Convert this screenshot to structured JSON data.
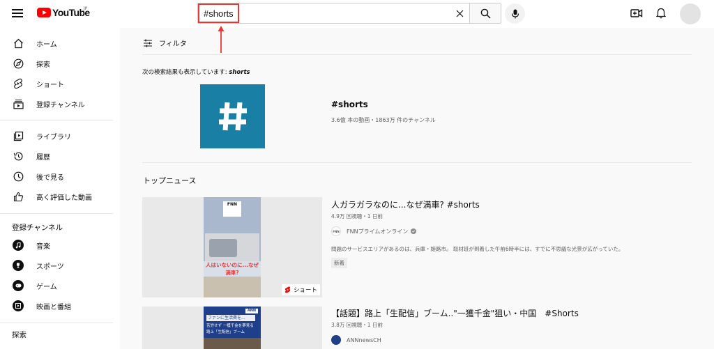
{
  "header": {
    "logo_text": "YouTube",
    "region": "JP",
    "search_value": "#shorts",
    "annotation_color": "#e53935"
  },
  "sidebar": {
    "main": [
      {
        "label": "ホーム",
        "icon": "home-icon"
      },
      {
        "label": "探索",
        "icon": "explore-icon"
      },
      {
        "label": "ショート",
        "icon": "shorts-icon"
      },
      {
        "label": "登録チャンネル",
        "icon": "subscriptions-icon"
      }
    ],
    "library": [
      {
        "label": "ライブラリ",
        "icon": "library-icon"
      },
      {
        "label": "履歴",
        "icon": "history-icon"
      },
      {
        "label": "後で見る",
        "icon": "watch-later-icon"
      },
      {
        "label": "高く評価した動画",
        "icon": "thumbs-up-icon"
      }
    ],
    "subs_heading": "登録チャンネル",
    "subs": [
      {
        "label": "音楽",
        "icon": "music-icon"
      },
      {
        "label": "スポーツ",
        "icon": "trophy-icon"
      },
      {
        "label": "ゲーム",
        "icon": "gaming-icon"
      },
      {
        "label": "映画と番組",
        "icon": "film-icon"
      }
    ],
    "explore_heading": "探索"
  },
  "filter_label": "フィルタ",
  "also_showing": {
    "prefix": "次の検索結果も表示しています: ",
    "term": "shorts"
  },
  "channel": {
    "title": "#shorts",
    "meta": "3.6億 本の動画・1863万 件のチャンネル",
    "color": "#1a7fa5"
  },
  "section_title": "トップニュース",
  "videos": [
    {
      "title": "人ガラガラなのに...なぜ満車? #shorts",
      "meta": "4.9万 回視聴・1 日前",
      "channel": "FNNプライムオンライン",
      "description": "問題のサービスエリアがあるのは、兵庫・姫路市。 取材班が到着した午前6時半には、すでに不思議な光景が広がっていた。",
      "tag": "新着",
      "badge": "ショート",
      "thumb_caption": "人はいないのに...なぜ満車?",
      "thumb_logo": "FNN"
    },
    {
      "title": "【話題】路上「生配信」ブーム..\"一獲千金\"狙い・中国　#Shorts",
      "meta": "3.8万 回視聴・1 日前",
      "channel": "ANNnewsCH",
      "thumb_caption_1": "ファンに生活費を...",
      "thumb_caption_2": "苦労せず 一獲千金を夢見る",
      "thumb_caption_3": "路上「生配信」ブーム",
      "thumb_logo": "ANN"
    }
  ]
}
